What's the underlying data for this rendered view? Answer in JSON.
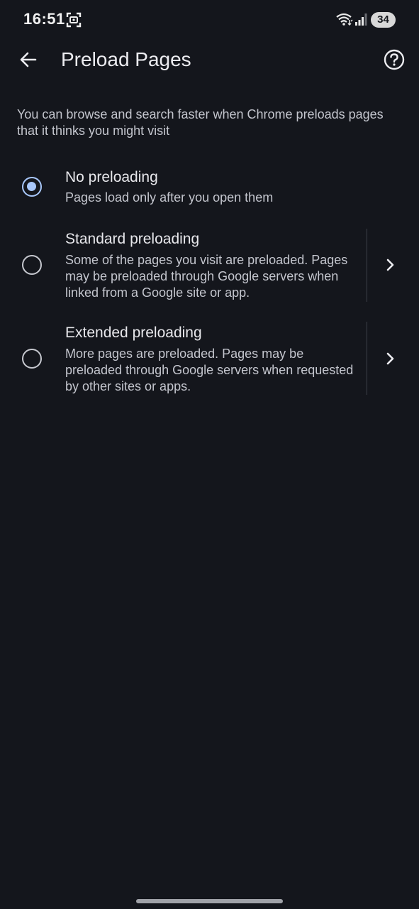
{
  "status_bar": {
    "time": "16:51",
    "battery": "34"
  },
  "app_bar": {
    "title": "Preload Pages"
  },
  "description": "You can browse and search faster when Chrome preloads pages that it thinks you might visit",
  "options": [
    {
      "title": "No preloading",
      "summary": "Pages load only after you open them",
      "selected": true
    },
    {
      "title": "Standard preloading",
      "summary": "Some of the pages you visit are preloaded. Pages may be preloaded through Google servers when linked from a Google site or app.",
      "selected": false
    },
    {
      "title": "Extended preloading",
      "summary": "More pages are preloaded. Pages may be preloaded through Google servers when requested by other sites or apps.",
      "selected": false
    }
  ],
  "colors": {
    "background": "#14161c",
    "accent": "#a8c7fa"
  }
}
